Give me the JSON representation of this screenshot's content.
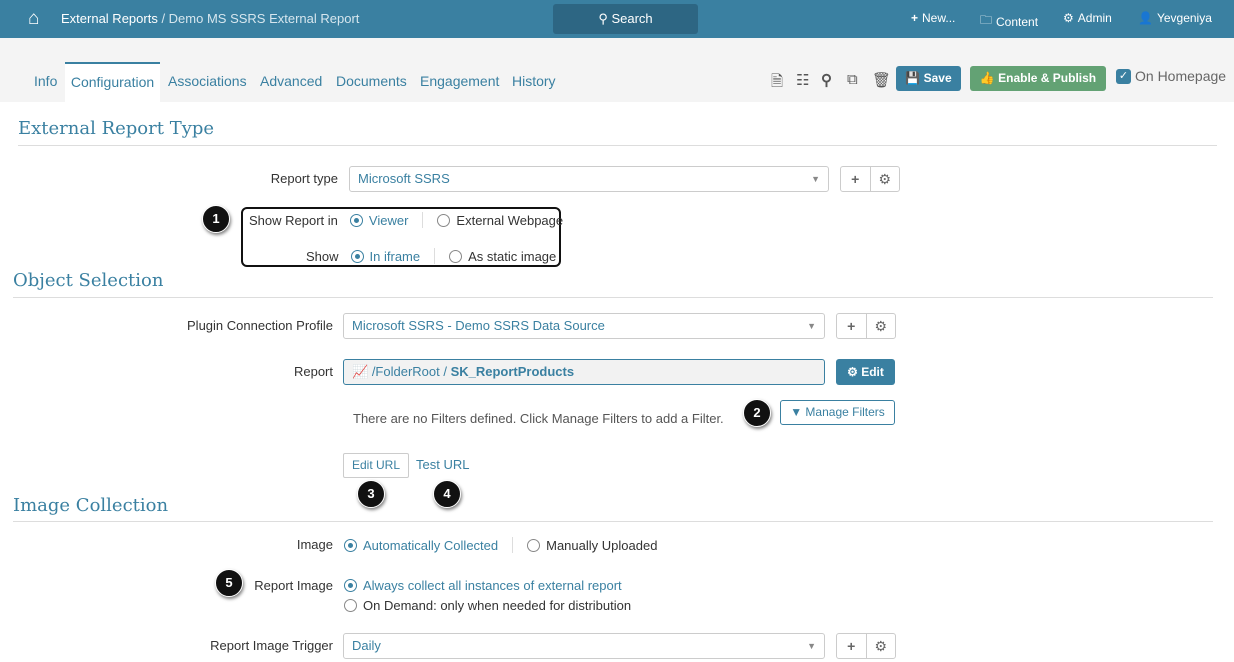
{
  "header": {
    "breadcrumb_root": "External Reports",
    "breadcrumb_sep": " / ",
    "breadcrumb_current": "Demo MS SSRS External Report",
    "search_label": "Search",
    "new_label": "New...",
    "content_label": "Content",
    "admin_label": "Admin",
    "user_label": "Yevgeniya"
  },
  "tabs": [
    "Info",
    "Configuration",
    "Associations",
    "Advanced",
    "Documents",
    "Engagement",
    "History"
  ],
  "toolbar": {
    "save_label": "Save",
    "publish_label": "Enable & Publish",
    "homepage_label": "On Homepage",
    "homepage_checked": true
  },
  "sections": {
    "type": {
      "title": "External Report Type",
      "report_type_label": "Report type",
      "report_type_value": "Microsoft SSRS",
      "show_in_label": "Show Report in",
      "show_in_options": [
        "Viewer",
        "External Webpage"
      ],
      "show_label": "Show",
      "show_options": [
        "In iframe",
        "As static image"
      ]
    },
    "object": {
      "title": "Object Selection",
      "profile_label": "Plugin Connection Profile",
      "profile_value": "Microsoft SSRS - Demo SSRS Data Source",
      "report_label": "Report",
      "report_path": "/FolderRoot / ",
      "report_name": "SK_ReportProducts",
      "edit_label": "Edit",
      "filters_text": "There are no Filters defined. Click Manage Filters to add a Filter.",
      "manage_filters_label": "Manage Filters",
      "edit_url_label": "Edit URL",
      "test_url_label": "Test URL"
    },
    "image": {
      "title": "Image Collection",
      "image_label": "Image",
      "image_options": [
        "Automatically Collected",
        "Manually Uploaded"
      ],
      "report_image_label": "Report Image",
      "report_image_options": [
        "Always collect all instances of external report",
        "On Demand: only when needed for distribution"
      ],
      "trigger_label": "Report Image Trigger",
      "trigger_value": "Daily"
    }
  },
  "badges": [
    "1",
    "2",
    "3",
    "4",
    "5"
  ],
  "colors": {
    "primary": "#3a80a1",
    "success": "#63a274"
  }
}
